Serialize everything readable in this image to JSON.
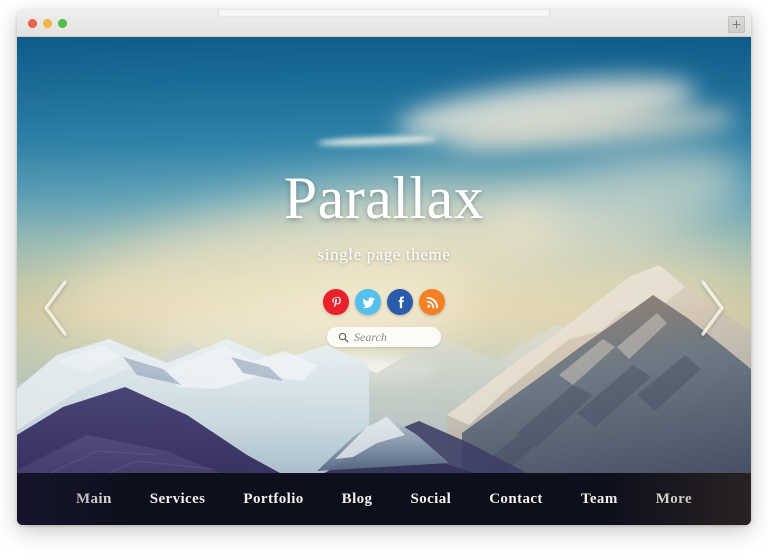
{
  "window": {
    "traffic_lights": [
      {
        "name": "close",
        "color": "#f0604c"
      },
      {
        "name": "minimize",
        "color": "#f6b93f"
      },
      {
        "name": "zoom",
        "color": "#4bc14a"
      }
    ]
  },
  "hero": {
    "title": "Parallax",
    "subtitle": "single page theme",
    "social": [
      {
        "name": "pinterest",
        "label": "Pinterest",
        "color": "#e8212b"
      },
      {
        "name": "twitter",
        "label": "Twitter",
        "color": "#55c0ee"
      },
      {
        "name": "facebook",
        "label": "Facebook",
        "color": "#2a5caa"
      },
      {
        "name": "rss",
        "label": "RSS",
        "color": "#f58024"
      }
    ],
    "search": {
      "placeholder": "Search",
      "value": "",
      "icon": "search-icon"
    },
    "slider": {
      "prev_icon": "chevron-left-icon",
      "next_icon": "chevron-right-icon"
    }
  },
  "nav": {
    "items": [
      {
        "label": "Main"
      },
      {
        "label": "Services"
      },
      {
        "label": "Portfolio"
      },
      {
        "label": "Blog"
      },
      {
        "label": "Social"
      },
      {
        "label": "Contact"
      },
      {
        "label": "Team"
      },
      {
        "label": "More"
      }
    ]
  },
  "theme": {
    "nav_background": "#0d0f1c",
    "sky_top": "#0e5f8e",
    "sky_bottom": "#aec4bd",
    "text_light": "#ffffff"
  }
}
